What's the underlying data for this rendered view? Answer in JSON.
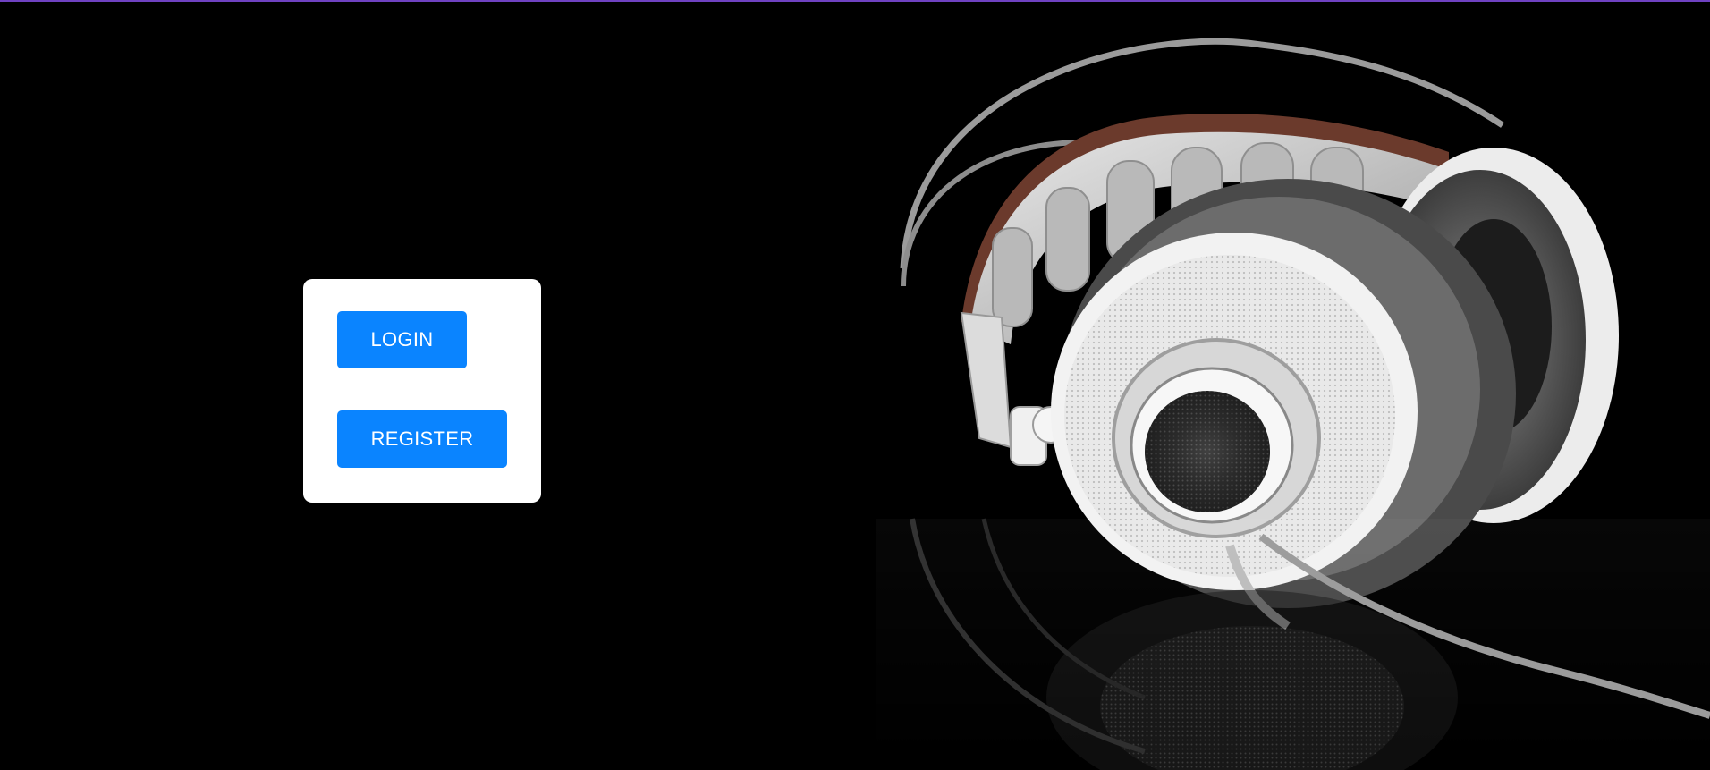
{
  "colors": {
    "background": "#000000",
    "top_accent": "#6f42c1",
    "card": "#ffffff",
    "button": "#0a84ff",
    "button_text": "#ffffff"
  },
  "hero": {
    "icon": "headphones-icon"
  },
  "auth": {
    "login_label": "LOGIN",
    "register_label": "REGISTER"
  }
}
